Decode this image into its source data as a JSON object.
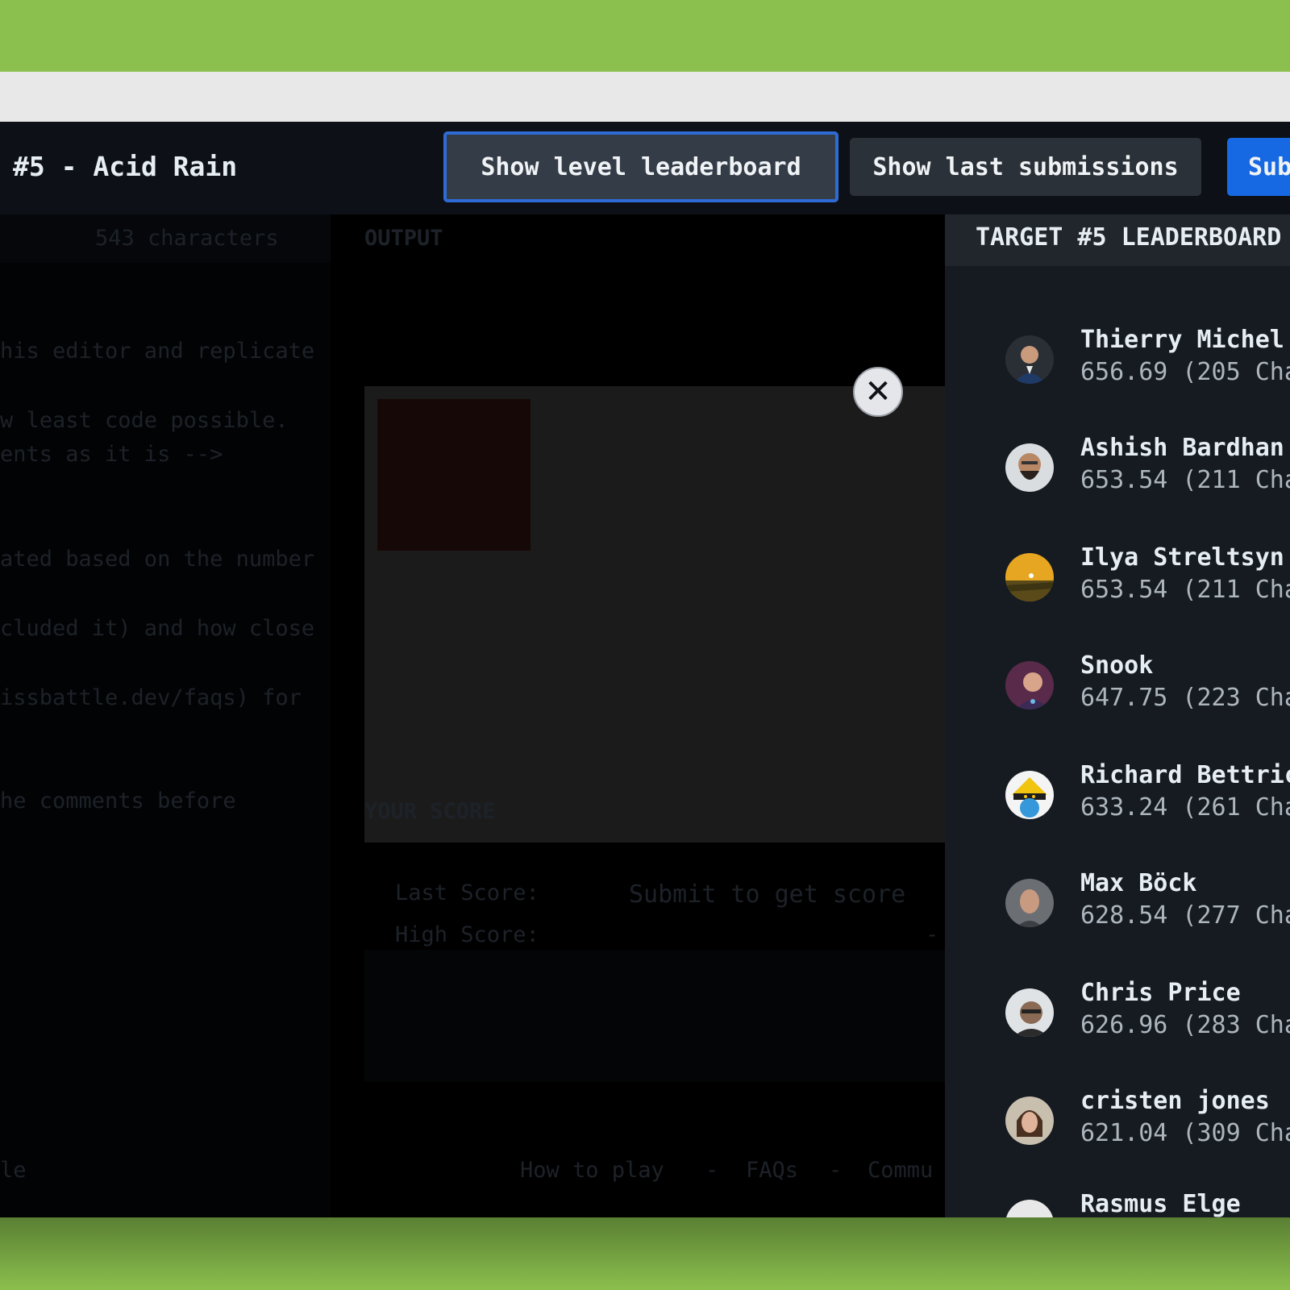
{
  "header": {
    "level_title": "#5 - Acid Rain",
    "show_leaderboard_label": "Show level leaderboard",
    "show_last_label": "Show last submissions",
    "submit_label": "Sub"
  },
  "editor": {
    "char_count": "543 characters",
    "lines": [
      "his editor and replicate",
      "w least code possible.",
      "ents as it is -->",
      "ated based on the number",
      "cluded it) and how close",
      "issbattle.dev/faqs) for",
      "he comments before"
    ]
  },
  "output": {
    "label": "OUTPUT"
  },
  "score": {
    "label": "YOUR SCORE",
    "last_label": "Last Score:",
    "last_value": "Submit to get score",
    "high_label": "High Score:",
    "high_value": "-"
  },
  "footer": {
    "left_text": "le",
    "how_to_play": "How to play",
    "sep1": "-",
    "faqs": "FAQs",
    "sep2": "-",
    "community": "Commu"
  },
  "close": {
    "icon": "close-icon",
    "glyph": "✕"
  },
  "leaderboard": {
    "title": "TARGET #5 LEADERBOARD",
    "entries": [
      {
        "name": "Thierry Michel",
        "score": "656.69 (205 Cha"
      },
      {
        "name": "Ashish Bardhan",
        "score": "653.54 (211 Cha"
      },
      {
        "name": "Ilya Streltsyn",
        "score": "653.54 (211 Cha"
      },
      {
        "name": "Snook",
        "score": "647.75 (223 Cha"
      },
      {
        "name": "Richard Bettric",
        "score": "633.24 (261 Cha"
      },
      {
        "name": "Max Böck",
        "score": "628.54 (277 Cha"
      },
      {
        "name": "Chris Price",
        "score": "626.96 (283 Cha"
      },
      {
        "name": "cristen jones",
        "score": "621.04 (309 Cha"
      },
      {
        "name": "Rasmus Elge",
        "score": ""
      }
    ]
  },
  "colors": {
    "accent_blue": "#1668e3",
    "leaderboard_outline": "#2f6bd4",
    "panel_bg": "#161b22",
    "green_bg": "#8bc04f"
  }
}
